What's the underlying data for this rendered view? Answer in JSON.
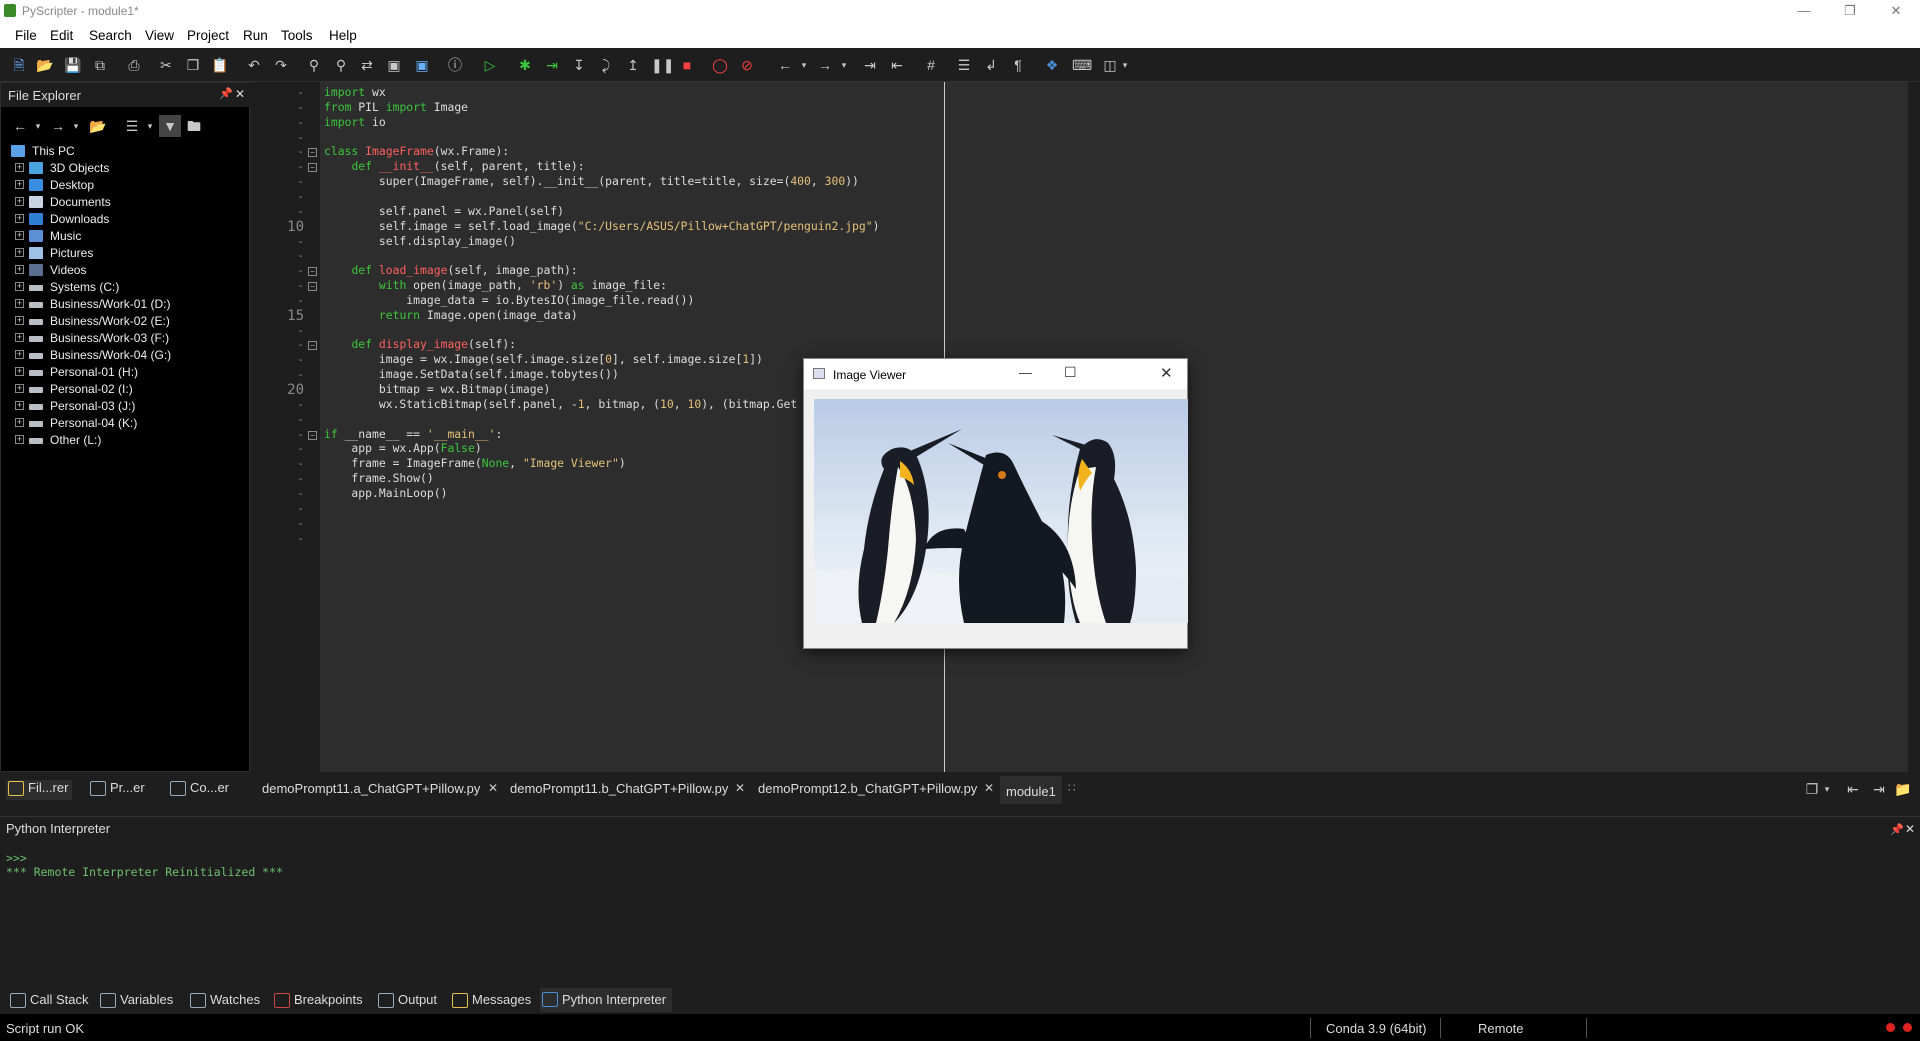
{
  "window": {
    "title": "PyScripter - module1*"
  },
  "menu": [
    "File",
    "Edit",
    "Search",
    "View",
    "Project",
    "Run",
    "Tools",
    "Help"
  ],
  "explorer": {
    "title": "File Explorer",
    "items": [
      {
        "label": "This PC",
        "icon": "computer-icon",
        "root": true
      },
      {
        "label": "3D Objects",
        "icon": "folder-3d-icon"
      },
      {
        "label": "Desktop",
        "icon": "desktop-icon"
      },
      {
        "label": "Documents",
        "icon": "documents-icon"
      },
      {
        "label": "Downloads",
        "icon": "downloads-icon"
      },
      {
        "label": "Music",
        "icon": "music-icon"
      },
      {
        "label": "Pictures",
        "icon": "pictures-icon"
      },
      {
        "label": "Videos",
        "icon": "videos-icon"
      },
      {
        "label": "Systems (C:)",
        "icon": "drive-icon"
      },
      {
        "label": "Business/Work-01 (D:)",
        "icon": "drive-icon"
      },
      {
        "label": "Business/Work-02 (E:)",
        "icon": "drive-icon"
      },
      {
        "label": "Business/Work-03 (F:)",
        "icon": "drive-icon"
      },
      {
        "label": "Business/Work-04 (G:)",
        "icon": "drive-icon"
      },
      {
        "label": "Personal-01 (H:)",
        "icon": "drive-icon"
      },
      {
        "label": "Personal-02 (I:)",
        "icon": "drive-icon"
      },
      {
        "label": "Personal-03 (J:)",
        "icon": "drive-icon"
      },
      {
        "label": "Personal-04 (K:)",
        "icon": "drive-icon"
      },
      {
        "label": "Other (L:)",
        "icon": "drive-icon"
      }
    ],
    "tabs": [
      "Fil...rer",
      "Pr...er",
      "Co...er"
    ]
  },
  "editor": {
    "line_numbers": [
      "-",
      "-",
      "-",
      "-",
      "-",
      "-",
      "-",
      "-",
      "-",
      "10",
      "-",
      "-",
      "-",
      "-",
      "-",
      "15",
      "-",
      "-",
      "-",
      "-",
      "20",
      "-",
      "-",
      "-",
      "-",
      "-",
      "-",
      "-",
      "-",
      "-",
      "-"
    ],
    "lines": [
      [
        [
          "kw",
          "import"
        ],
        [
          "op",
          " wx"
        ]
      ],
      [
        [
          "kw",
          "from"
        ],
        [
          "op",
          " PIL "
        ],
        [
          "kw",
          "import"
        ],
        [
          "op",
          " Image"
        ]
      ],
      [
        [
          "kw",
          "import"
        ],
        [
          "op",
          " io"
        ]
      ],
      [],
      [
        [
          "kw",
          "class"
        ],
        [
          "op",
          " "
        ],
        [
          "fn",
          "ImageFrame"
        ],
        [
          "op",
          "(wx.Frame):"
        ]
      ],
      [
        [
          "op",
          "    "
        ],
        [
          "kw",
          "def"
        ],
        [
          "op",
          " "
        ],
        [
          "fn",
          "__init__"
        ],
        [
          "op",
          "(self, parent, title):"
        ]
      ],
      [
        [
          "op",
          "        super(ImageFrame, self).__init__(parent, title=title, size=("
        ],
        [
          "nm",
          "400"
        ],
        [
          "op",
          ", "
        ],
        [
          "nm",
          "300"
        ],
        [
          "op",
          "))"
        ]
      ],
      [],
      [
        [
          "op",
          "        self.panel = wx.Panel(self)"
        ]
      ],
      [
        [
          "op",
          "        self.image = self.load_image("
        ],
        [
          "st",
          "\"C:/Users/ASUS/Pillow+ChatGPT/penguin2.jpg\""
        ],
        [
          "op",
          ")"
        ]
      ],
      [
        [
          "op",
          "        self.display_image()"
        ]
      ],
      [],
      [
        [
          "op",
          "    "
        ],
        [
          "kw",
          "def"
        ],
        [
          "op",
          " "
        ],
        [
          "fn",
          "load_image"
        ],
        [
          "op",
          "(self, image_path):"
        ]
      ],
      [
        [
          "op",
          "        "
        ],
        [
          "kw",
          "with"
        ],
        [
          "op",
          " open(image_path, "
        ],
        [
          "st",
          "'rb'"
        ],
        [
          "op",
          ") "
        ],
        [
          "kw",
          "as"
        ],
        [
          "op",
          " image_file:"
        ]
      ],
      [
        [
          "op",
          "            image_data = io.BytesIO(image_file.read())"
        ]
      ],
      [
        [
          "op",
          "        "
        ],
        [
          "kw",
          "return"
        ],
        [
          "op",
          " Image.open(image_data)"
        ]
      ],
      [],
      [
        [
          "op",
          "    "
        ],
        [
          "kw",
          "def"
        ],
        [
          "op",
          " "
        ],
        [
          "fn",
          "display_image"
        ],
        [
          "op",
          "(self):"
        ]
      ],
      [
        [
          "op",
          "        image = wx.Image(self.image.size["
        ],
        [
          "nm",
          "0"
        ],
        [
          "op",
          "], self.image.size["
        ],
        [
          "nm",
          "1"
        ],
        [
          "op",
          "])"
        ]
      ],
      [
        [
          "op",
          "        image.SetData(self.image.tobytes())"
        ]
      ],
      [
        [
          "op",
          "        bitmap = wx.Bitmap(image)"
        ]
      ],
      [
        [
          "op",
          "        wx.StaticBitmap(self.panel, -"
        ],
        [
          "nm",
          "1"
        ],
        [
          "op",
          ", bitmap, ("
        ],
        [
          "nm",
          "10"
        ],
        [
          "op",
          ", "
        ],
        [
          "nm",
          "10"
        ],
        [
          "op",
          "), (bitmap.Get"
        ]
      ],
      [],
      [
        [
          "kw",
          "if"
        ],
        [
          "op",
          " __name__ == "
        ],
        [
          "st",
          "'__main__'"
        ],
        [
          "op",
          ":"
        ]
      ],
      [
        [
          "op",
          "    app = wx.App("
        ],
        [
          "kw",
          "False"
        ],
        [
          "op",
          ")"
        ]
      ],
      [
        [
          "op",
          "    frame = ImageFrame("
        ],
        [
          "kw",
          "None"
        ],
        [
          "op",
          ", "
        ],
        [
          "st",
          "\"Image Viewer\""
        ],
        [
          "op",
          ")"
        ]
      ],
      [
        [
          "op",
          "    frame.Show()"
        ]
      ],
      [
        [
          "op",
          "    app.MainLoop()"
        ]
      ],
      [],
      []
    ],
    "tabs": [
      {
        "label": "demoPrompt11.a_ChatGPT+Pillow.py",
        "active": false
      },
      {
        "label": "demoPrompt11.b_ChatGPT+Pillow.py",
        "active": false
      },
      {
        "label": "demoPrompt12.b_ChatGPT+Pillow.py",
        "active": false
      },
      {
        "label": "module1",
        "active": true
      }
    ]
  },
  "viewer": {
    "title": "Image Viewer"
  },
  "interpreter": {
    "title": "Python Interpreter",
    "prompt": ">>>",
    "message": "*** Remote Interpreter Reinitialized ***"
  },
  "bottom_tabs": [
    "Call Stack",
    "Variables",
    "Watches",
    "Breakpoints",
    "Output",
    "Messages",
    "Python Interpreter"
  ],
  "status": {
    "left": "Script run OK",
    "env": "Conda 3.9 (64bit)",
    "mode": "Remote"
  },
  "colors": {
    "keyword": "#3dc53d",
    "function": "#ff6060",
    "string": "#e5c07b",
    "accent": "#3dc53d"
  }
}
